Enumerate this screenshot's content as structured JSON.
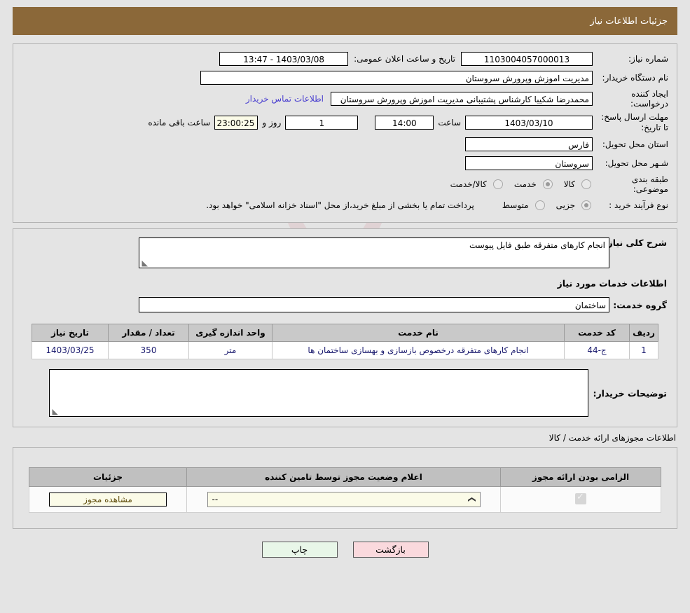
{
  "header": {
    "title": "جزئیات اطلاعات نیاز"
  },
  "watermark": {
    "text": "AriaTender.net"
  },
  "details": {
    "need_number_label": "شماره نیاز:",
    "need_number_value": "1103004057000013",
    "announce_datetime_label": "تاریخ و ساعت اعلان عمومی:",
    "announce_datetime_value": "1403/03/08 - 13:47",
    "buyer_org_label": "نام دستگاه خریدار:",
    "buyer_org_value": "مدیریت اموزش وپرورش سروستان",
    "requester_label": "ایجاد کننده درخواست:",
    "requester_value": "محمدرضا شکیبا کارشناس پشتیبانی مدیریت اموزش وپرورش سروستان",
    "contact_link": "اطلاعات تماس خریدار",
    "deadline_label": "مهلت ارسال پاسخ: تا تاریخ:",
    "deadline_date": "1403/03/10",
    "deadline_hour_label": "ساعت",
    "deadline_hour": "14:00",
    "remaining_days": "1",
    "remaining_days_label": "روز و",
    "remaining_time": "23:00:25",
    "remaining_time_label": "ساعت باقی مانده",
    "province_label": "استان محل تحویل:",
    "province_value": "فارس",
    "city_label": "شـهر محل تحویل:",
    "city_value": "سروستان",
    "category_label": "طبقه بندی موضوعی:",
    "category_options": [
      {
        "label": "کالا",
        "selected": false
      },
      {
        "label": "خدمت",
        "selected": true
      },
      {
        "label": "کالا/خدمت",
        "selected": false
      }
    ],
    "process_label": "نوع فرآیند خرید :",
    "process_options": [
      {
        "label": "جزیی",
        "selected": true
      },
      {
        "label": "متوسط",
        "selected": false
      }
    ],
    "process_note": "پرداخت تمام یا بخشی از مبلغ خرید،از محل \"اسناد خزانه اسلامی\" خواهد بود."
  },
  "need_section": {
    "summary_label": "شرح کلی نیاز:",
    "summary_value": "انجام کارهای متفرقه طبق فایل پیوست",
    "services_heading": "اطلاعات خدمات مورد نیاز",
    "service_group_label": "گروه خدمت:",
    "service_group_value": "ساختمان",
    "table": {
      "headers": [
        "ردیف",
        "کد خدمت",
        "نام خدمت",
        "واحد اندازه گیری",
        "تعداد / مقدار",
        "تاریخ نیاز"
      ],
      "rows": [
        {
          "row": "1",
          "code": "ج-44",
          "name": "انجام کارهای متفرقه درخصوص بازسازی و بهسازی ساختمان ها",
          "unit": "متر",
          "qty": "350",
          "date": "1403/03/25"
        }
      ]
    },
    "buyer_notes_label": "توضیحات خریدار:",
    "buyer_notes_value": ""
  },
  "licenses": {
    "caption": "اطلاعات مجوزهای ارائه خدمت / کالا",
    "headers": [
      "الزامی بودن ارائه مجوز",
      "اعلام وضعیت مجوز توسط تامین کننده",
      "جزئیات"
    ],
    "rows": [
      {
        "required_checked": true,
        "status_value": "--",
        "details_button": "مشاهده مجوز"
      }
    ]
  },
  "footer": {
    "print_label": "چاپ",
    "back_label": "بازگشت"
  }
}
